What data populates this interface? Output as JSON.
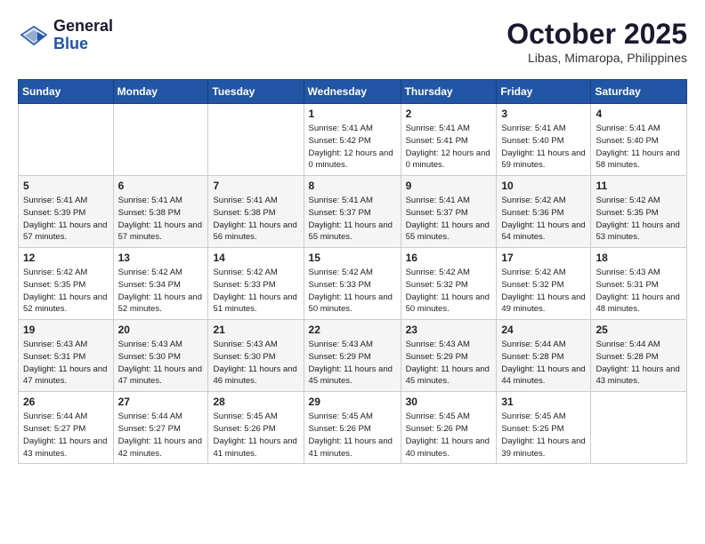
{
  "logo": {
    "line1": "General",
    "line2": "Blue"
  },
  "header": {
    "month": "October 2025",
    "location": "Libas, Mimaropa, Philippines"
  },
  "weekdays": [
    "Sunday",
    "Monday",
    "Tuesday",
    "Wednesday",
    "Thursday",
    "Friday",
    "Saturday"
  ],
  "weeks": [
    [
      {
        "day": "",
        "sunrise": "",
        "sunset": "",
        "daylight": ""
      },
      {
        "day": "",
        "sunrise": "",
        "sunset": "",
        "daylight": ""
      },
      {
        "day": "",
        "sunrise": "",
        "sunset": "",
        "daylight": ""
      },
      {
        "day": "1",
        "sunrise": "Sunrise: 5:41 AM",
        "sunset": "Sunset: 5:42 PM",
        "daylight": "Daylight: 12 hours and 0 minutes."
      },
      {
        "day": "2",
        "sunrise": "Sunrise: 5:41 AM",
        "sunset": "Sunset: 5:41 PM",
        "daylight": "Daylight: 12 hours and 0 minutes."
      },
      {
        "day": "3",
        "sunrise": "Sunrise: 5:41 AM",
        "sunset": "Sunset: 5:40 PM",
        "daylight": "Daylight: 11 hours and 59 minutes."
      },
      {
        "day": "4",
        "sunrise": "Sunrise: 5:41 AM",
        "sunset": "Sunset: 5:40 PM",
        "daylight": "Daylight: 11 hours and 58 minutes."
      }
    ],
    [
      {
        "day": "5",
        "sunrise": "Sunrise: 5:41 AM",
        "sunset": "Sunset: 5:39 PM",
        "daylight": "Daylight: 11 hours and 57 minutes."
      },
      {
        "day": "6",
        "sunrise": "Sunrise: 5:41 AM",
        "sunset": "Sunset: 5:38 PM",
        "daylight": "Daylight: 11 hours and 57 minutes."
      },
      {
        "day": "7",
        "sunrise": "Sunrise: 5:41 AM",
        "sunset": "Sunset: 5:38 PM",
        "daylight": "Daylight: 11 hours and 56 minutes."
      },
      {
        "day": "8",
        "sunrise": "Sunrise: 5:41 AM",
        "sunset": "Sunset: 5:37 PM",
        "daylight": "Daylight: 11 hours and 55 minutes."
      },
      {
        "day": "9",
        "sunrise": "Sunrise: 5:41 AM",
        "sunset": "Sunset: 5:37 PM",
        "daylight": "Daylight: 11 hours and 55 minutes."
      },
      {
        "day": "10",
        "sunrise": "Sunrise: 5:42 AM",
        "sunset": "Sunset: 5:36 PM",
        "daylight": "Daylight: 11 hours and 54 minutes."
      },
      {
        "day": "11",
        "sunrise": "Sunrise: 5:42 AM",
        "sunset": "Sunset: 5:35 PM",
        "daylight": "Daylight: 11 hours and 53 minutes."
      }
    ],
    [
      {
        "day": "12",
        "sunrise": "Sunrise: 5:42 AM",
        "sunset": "Sunset: 5:35 PM",
        "daylight": "Daylight: 11 hours and 52 minutes."
      },
      {
        "day": "13",
        "sunrise": "Sunrise: 5:42 AM",
        "sunset": "Sunset: 5:34 PM",
        "daylight": "Daylight: 11 hours and 52 minutes."
      },
      {
        "day": "14",
        "sunrise": "Sunrise: 5:42 AM",
        "sunset": "Sunset: 5:33 PM",
        "daylight": "Daylight: 11 hours and 51 minutes."
      },
      {
        "day": "15",
        "sunrise": "Sunrise: 5:42 AM",
        "sunset": "Sunset: 5:33 PM",
        "daylight": "Daylight: 11 hours and 50 minutes."
      },
      {
        "day": "16",
        "sunrise": "Sunrise: 5:42 AM",
        "sunset": "Sunset: 5:32 PM",
        "daylight": "Daylight: 11 hours and 50 minutes."
      },
      {
        "day": "17",
        "sunrise": "Sunrise: 5:42 AM",
        "sunset": "Sunset: 5:32 PM",
        "daylight": "Daylight: 11 hours and 49 minutes."
      },
      {
        "day": "18",
        "sunrise": "Sunrise: 5:43 AM",
        "sunset": "Sunset: 5:31 PM",
        "daylight": "Daylight: 11 hours and 48 minutes."
      }
    ],
    [
      {
        "day": "19",
        "sunrise": "Sunrise: 5:43 AM",
        "sunset": "Sunset: 5:31 PM",
        "daylight": "Daylight: 11 hours and 47 minutes."
      },
      {
        "day": "20",
        "sunrise": "Sunrise: 5:43 AM",
        "sunset": "Sunset: 5:30 PM",
        "daylight": "Daylight: 11 hours and 47 minutes."
      },
      {
        "day": "21",
        "sunrise": "Sunrise: 5:43 AM",
        "sunset": "Sunset: 5:30 PM",
        "daylight": "Daylight: 11 hours and 46 minutes."
      },
      {
        "day": "22",
        "sunrise": "Sunrise: 5:43 AM",
        "sunset": "Sunset: 5:29 PM",
        "daylight": "Daylight: 11 hours and 45 minutes."
      },
      {
        "day": "23",
        "sunrise": "Sunrise: 5:43 AM",
        "sunset": "Sunset: 5:29 PM",
        "daylight": "Daylight: 11 hours and 45 minutes."
      },
      {
        "day": "24",
        "sunrise": "Sunrise: 5:44 AM",
        "sunset": "Sunset: 5:28 PM",
        "daylight": "Daylight: 11 hours and 44 minutes."
      },
      {
        "day": "25",
        "sunrise": "Sunrise: 5:44 AM",
        "sunset": "Sunset: 5:28 PM",
        "daylight": "Daylight: 11 hours and 43 minutes."
      }
    ],
    [
      {
        "day": "26",
        "sunrise": "Sunrise: 5:44 AM",
        "sunset": "Sunset: 5:27 PM",
        "daylight": "Daylight: 11 hours and 43 minutes."
      },
      {
        "day": "27",
        "sunrise": "Sunrise: 5:44 AM",
        "sunset": "Sunset: 5:27 PM",
        "daylight": "Daylight: 11 hours and 42 minutes."
      },
      {
        "day": "28",
        "sunrise": "Sunrise: 5:45 AM",
        "sunset": "Sunset: 5:26 PM",
        "daylight": "Daylight: 11 hours and 41 minutes."
      },
      {
        "day": "29",
        "sunrise": "Sunrise: 5:45 AM",
        "sunset": "Sunset: 5:26 PM",
        "daylight": "Daylight: 11 hours and 41 minutes."
      },
      {
        "day": "30",
        "sunrise": "Sunrise: 5:45 AM",
        "sunset": "Sunset: 5:26 PM",
        "daylight": "Daylight: 11 hours and 40 minutes."
      },
      {
        "day": "31",
        "sunrise": "Sunrise: 5:45 AM",
        "sunset": "Sunset: 5:25 PM",
        "daylight": "Daylight: 11 hours and 39 minutes."
      },
      {
        "day": "",
        "sunrise": "",
        "sunset": "",
        "daylight": ""
      }
    ]
  ]
}
